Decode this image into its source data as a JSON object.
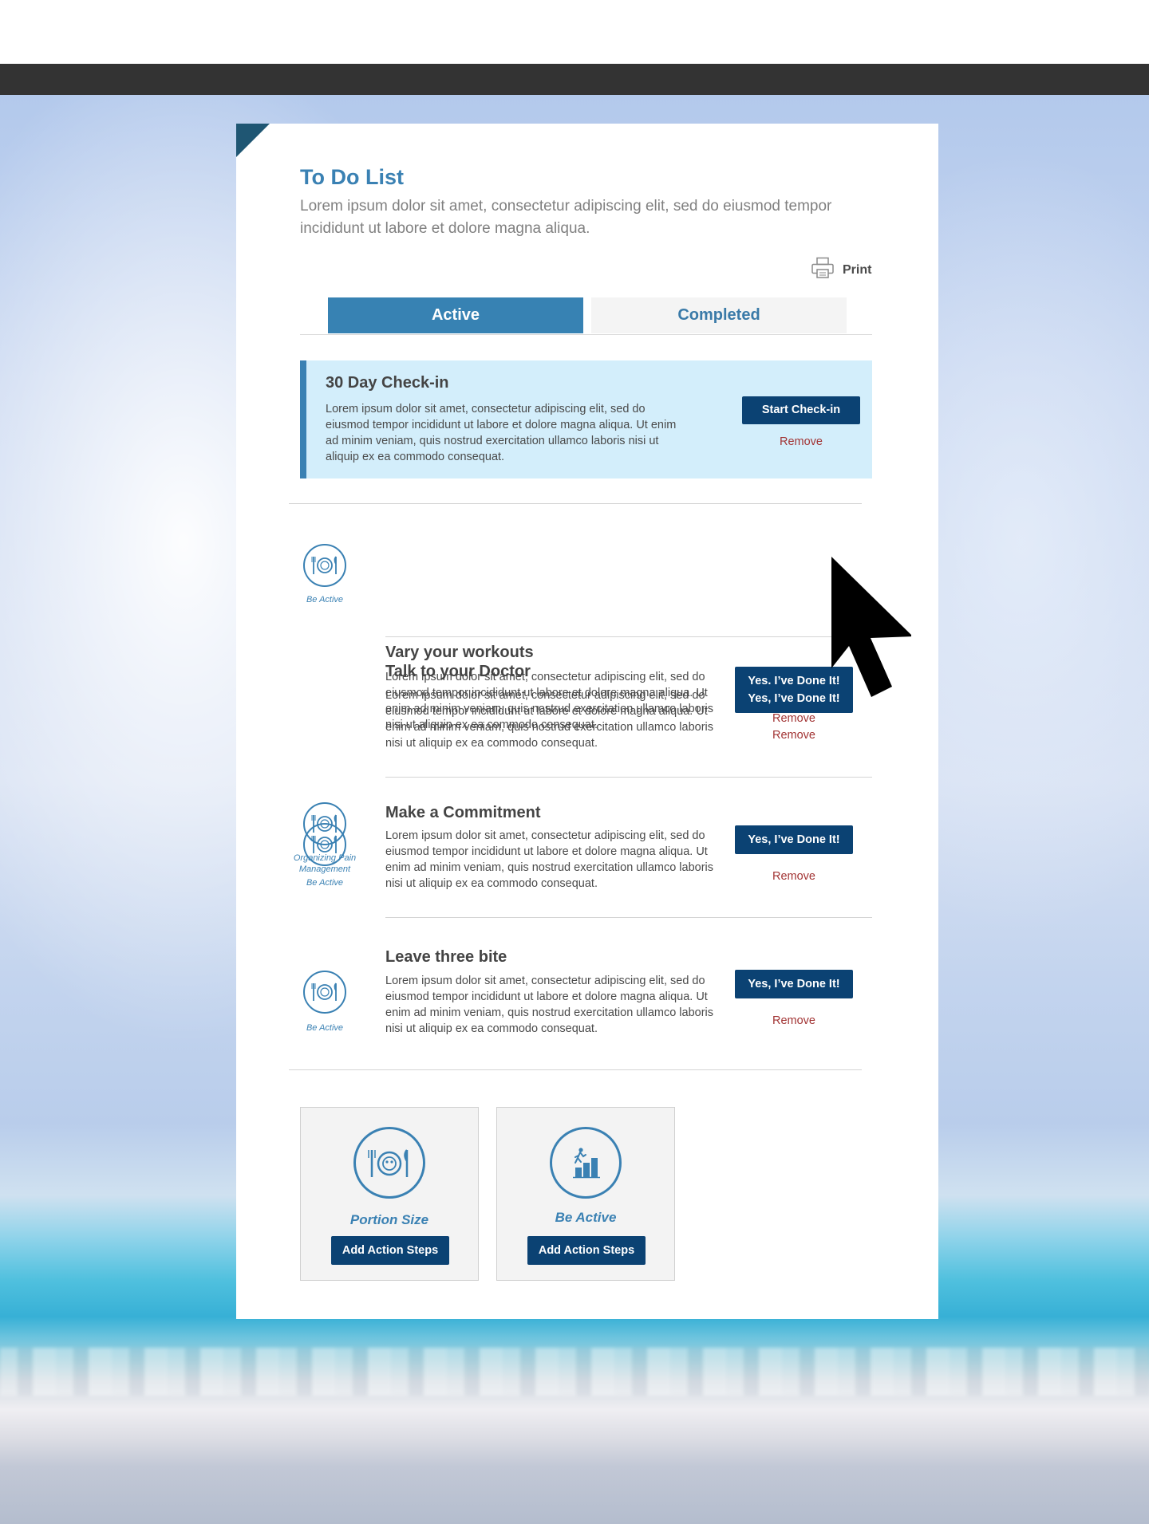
{
  "page": {
    "title": "To Do List",
    "subtitle": "Lorem ipsum dolor sit amet, consectetur adipiscing elit, sed do eiusmod tempor incididunt ut labore et dolore magna aliqua.",
    "print_label": "Print"
  },
  "tabs": [
    {
      "label": "Active",
      "selected": true
    },
    {
      "label": "Completed",
      "selected": false
    }
  ],
  "checkin": {
    "title": "30 Day Check-in",
    "text": "Lorem ipsum dolor sit amet, consectetur adipiscing elit, sed do eiusmod tempor incididunt ut labore et dolore magna aliqua. Ut enim ad minim veniam, quis nostrud exercitation ullamco laboris nisi ut aliquip ex ea commodo consequat.",
    "button": "Start Check-in",
    "remove": "Remove"
  },
  "tasks": [
    {
      "title": "Vary your workouts",
      "text": "Lorem ipsum dolor sit amet, consectetur adipiscing elit, sed do eiusmod tempor incididunt ut labore et dolore magna aliqua. Ut enim ad minim veniam, quis nostrud exercitation ullamco laboris nisi ut aliquip ex ea commodo consequat.",
      "category": "Be Active",
      "icon": "plate-fork-knife-icon",
      "button": "Yes, I’ve Done It!",
      "remove": "Remove"
    },
    {
      "title": "Talk to your Doctor",
      "text": "Lorem ipsum dolor sit amet, consectetur adipiscing elit, sed do eiusmod tempor incididunt ut labore et dolore magna aliqua. Ut enim ad minim veniam, quis nostrud exercitation ullamco laboris nisi ut aliquip ex ea commodo consequat.",
      "category": "Organizing Pain Management",
      "icon": "plate-fork-knife-icon",
      "button": "Yes, I’ve Done It!",
      "remove": "Remove"
    },
    {
      "title": "Make a Commitment",
      "text": "Lorem ipsum dolor sit amet, consectetur adipiscing elit, sed do eiusmod tempor incididunt ut labore et dolore magna aliqua. Ut enim ad minim veniam, quis nostrud exercitation ullamco laboris nisi ut aliquip ex ea commodo consequat.",
      "category": "Be Active",
      "icon": "plate-fork-knife-icon",
      "button": "Yes, I’ve Done It!",
      "remove": "Remove"
    },
    {
      "title": "Leave three bite",
      "text": "Lorem ipsum dolor sit amet, consectetur adipiscing elit, sed do eiusmod tempor incididunt ut labore et dolore magna aliqua. Ut enim ad minim veniam, quis nostrud exercitation ullamco laboris nisi ut aliquip ex ea commodo consequat.",
      "category": "Be Active",
      "icon": "plate-fork-knife-icon",
      "button": "Yes, I’ve Done It!",
      "remove": "Remove"
    }
  ],
  "categories": [
    {
      "label": "Portion Size",
      "icon": "plate-fork-knife-icon",
      "button": "Add Action Steps"
    },
    {
      "label": "Be Active",
      "icon": "bar-chart-runner-icon",
      "button": "Add Action Steps"
    }
  ],
  "colors": {
    "accent": "#3a81b3",
    "button": "#0b4273",
    "remove": "#a23434",
    "highlight": "#d3eefb",
    "topbar": "#333333"
  }
}
